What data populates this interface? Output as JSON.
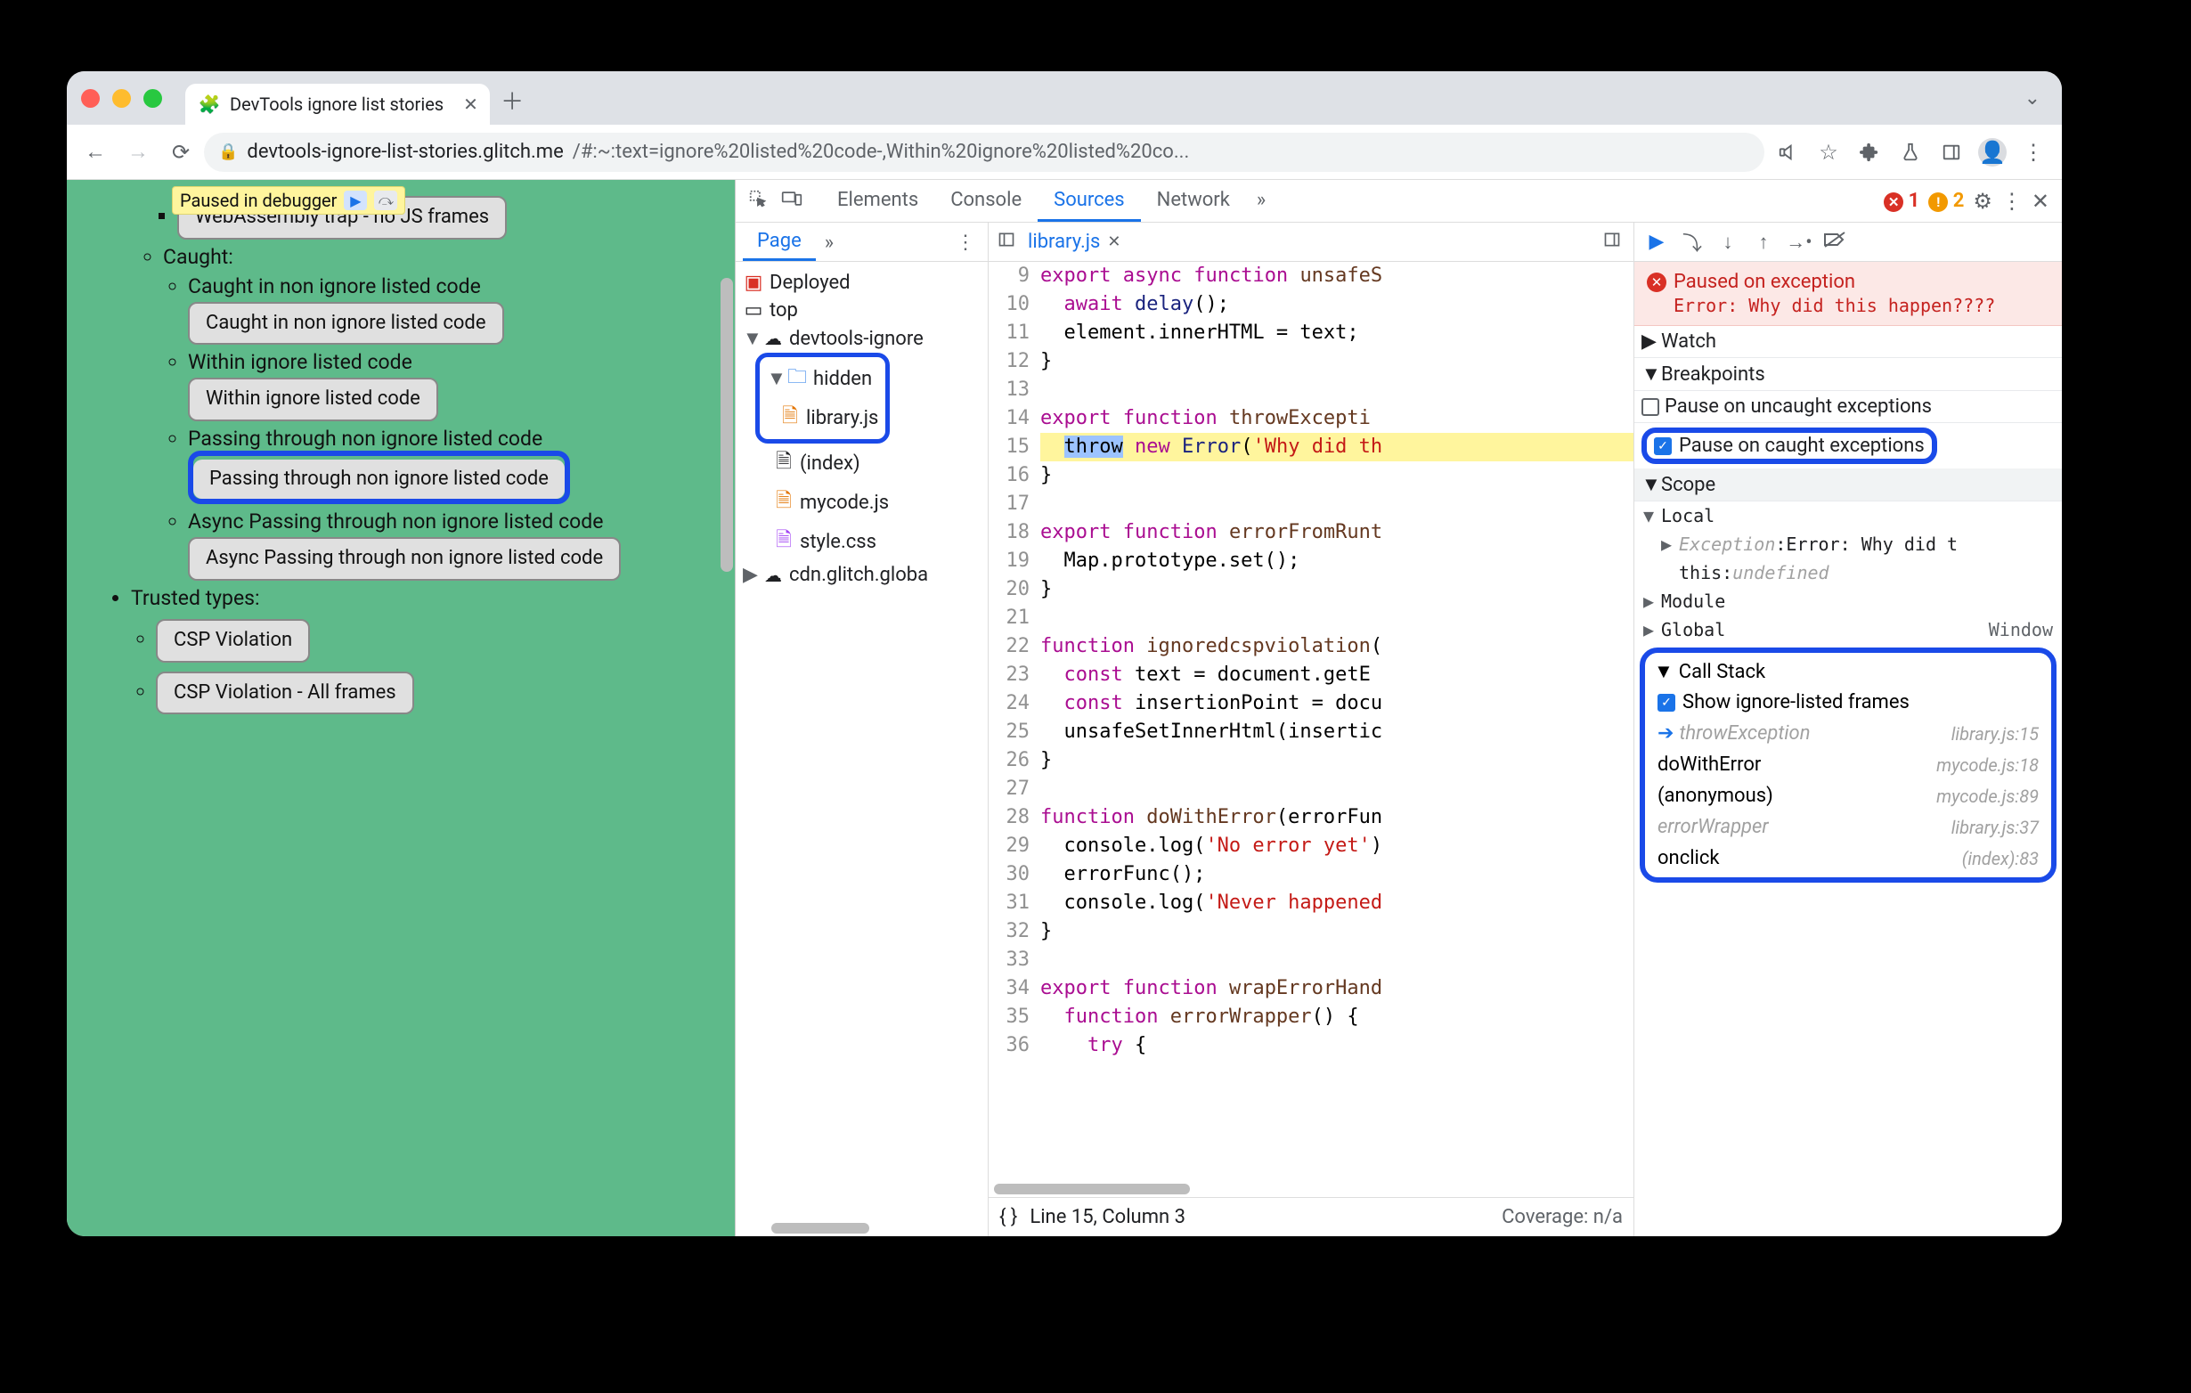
{
  "chrome": {
    "tab_title": "DevTools ignore list stories",
    "url_host": "devtools-ignore-list-stories.glitch.me",
    "url_path": "/#:~:text=ignore%20listed%20code-,Within%20ignore%20listed%20co..."
  },
  "paused_overlay": {
    "label": "Paused in debugger"
  },
  "page_content": {
    "partial_top": "WebAssembly trap - no JS frames",
    "caught_label": "Caught:",
    "items": [
      {
        "text": "Caught in non ignore listed code",
        "btn": "Caught in non ignore listed code"
      },
      {
        "text": "Within ignore listed code",
        "btn": "Within ignore listed code"
      },
      {
        "text": "Passing through non ignore listed code",
        "btn": "Passing through non ignore listed code",
        "highlight": true
      },
      {
        "text": "Async Passing through non ignore listed code",
        "btn": "Async Passing through non ignore listed code"
      }
    ],
    "trusted_types": "Trusted types:",
    "tt_items": [
      "CSP Violation",
      "CSP Violation - All frames"
    ]
  },
  "devtools": {
    "tabs": {
      "elements": "Elements",
      "console": "Console",
      "sources": "Sources",
      "network": "Network"
    },
    "error_count": "1",
    "warn_count": "2",
    "sources_left": {
      "page_tab": "Page"
    },
    "tree": {
      "deployed": "Deployed",
      "top": "top",
      "domain": "devtools-ignore",
      "hidden_folder": "hidden",
      "library_file": "library.js",
      "index_file": "(index)",
      "mycode_file": "mycode.js",
      "style_file": "style.css",
      "cdn": "cdn.glitch.globa"
    },
    "editor": {
      "open_file": "library.js",
      "lines": [
        {
          "n": 9,
          "html": "<span class='kw-purple'>export</span> <span class='kw-purple'>async</span> <span class='kw-purple'>function</span> <span class='fn-brown'>unsafeS</span>"
        },
        {
          "n": 10,
          "html": "  <span class='kw-purple'>await</span> <span class='kw-blue'>delay</span>();"
        },
        {
          "n": 11,
          "html": "  element.innerHTML = text;"
        },
        {
          "n": 12,
          "html": "}"
        },
        {
          "n": 13,
          "html": ""
        },
        {
          "n": 14,
          "html": "<span class='kw-purple'>export</span> <span class='kw-purple'>function</span> <span class='fn-brown'>throwExcepti</span>"
        },
        {
          "n": 15,
          "html": "  <span class='hl-throw'>throw</span> <span class='kw-purple'>new</span> <span class='kw-blue'>Error</span>(<span class='str-red'>'Why did th</span>",
          "hl": true
        },
        {
          "n": 16,
          "html": "}"
        },
        {
          "n": 17,
          "html": ""
        },
        {
          "n": 18,
          "html": "<span class='kw-purple'>export</span> <span class='kw-purple'>function</span> <span class='fn-brown'>errorFromRunt</span>"
        },
        {
          "n": 19,
          "html": "  Map.prototype.set();"
        },
        {
          "n": 20,
          "html": "}"
        },
        {
          "n": 21,
          "html": ""
        },
        {
          "n": 22,
          "html": "<span class='kw-purple'>function</span> <span class='fn-brown'>ignoredcspviolation</span>("
        },
        {
          "n": 23,
          "html": "  <span class='kw-purple'>const</span> text = document.getE"
        },
        {
          "n": 24,
          "html": "  <span class='kw-purple'>const</span> insertionPoint = docu"
        },
        {
          "n": 25,
          "html": "  unsafeSetInnerHtml(insertic"
        },
        {
          "n": 26,
          "html": "}"
        },
        {
          "n": 27,
          "html": ""
        },
        {
          "n": 28,
          "html": "<span class='kw-purple'>function</span> <span class='fn-brown'>doWithError</span>(errorFun"
        },
        {
          "n": 29,
          "html": "  console.log(<span class='str-red'>'No error yet'</span>)"
        },
        {
          "n": 30,
          "html": "  errorFunc();"
        },
        {
          "n": 31,
          "html": "  console.log(<span class='str-red'>'Never happened</span>"
        },
        {
          "n": 32,
          "html": "}"
        },
        {
          "n": 33,
          "html": ""
        },
        {
          "n": 34,
          "html": "<span class='kw-purple'>export</span> <span class='kw-purple'>function</span> <span class='fn-brown'>wrapErrorHand</span>"
        },
        {
          "n": 35,
          "html": "  <span class='kw-purple'>function</span> <span class='fn-brown'>errorWrapper</span>() {"
        },
        {
          "n": 36,
          "html": "    <span class='kw-purple'>try</span> {"
        }
      ],
      "status_line": "Line 15, Column 3",
      "coverage": "Coverage: n/a"
    },
    "dbg": {
      "paused_title": "Paused on exception",
      "paused_msg": "Error: Why did this happen????",
      "watch": "Watch",
      "breakpoints": "Breakpoints",
      "bp_uncaught": "Pause on uncaught exceptions",
      "bp_caught": "Pause on caught exceptions",
      "scope": "Scope",
      "local": "Local",
      "exception_label": "Exception",
      "exception_val": "Error: Why did t",
      "this_label": "this",
      "this_val": "undefined",
      "module": "Module",
      "global": "Global",
      "global_val": "Window",
      "callstack": "Call Stack",
      "show_ignored": "Show ignore-listed frames",
      "frames": [
        {
          "fn": "throwException",
          "loc": "library.js:15",
          "ignored": true,
          "active": true
        },
        {
          "fn": "doWithError",
          "loc": "mycode.js:18"
        },
        {
          "fn": "(anonymous)",
          "loc": "mycode.js:89"
        },
        {
          "fn": "errorWrapper",
          "loc": "library.js:37",
          "ignored": true
        },
        {
          "fn": "onclick",
          "loc": "(index):83"
        }
      ]
    }
  }
}
